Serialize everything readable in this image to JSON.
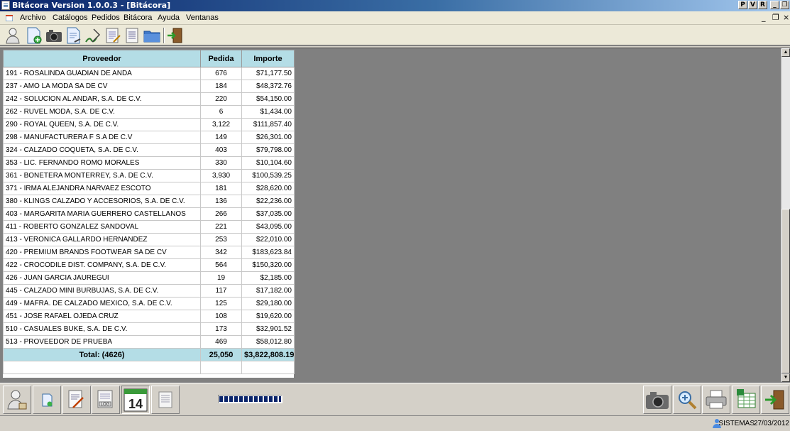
{
  "window": {
    "title": "Bitácora Version 1.0.0.3 - [Bitácora]",
    "caption_buttons": [
      "P",
      "V",
      "R",
      "_",
      "❐",
      "✕"
    ]
  },
  "menu": {
    "items": [
      "Archivo",
      "Catálogos",
      "Pedidos",
      "Bitácora",
      "Ayuda",
      "Ventanas"
    ],
    "mdi_controls": [
      "_",
      "❐",
      "×"
    ]
  },
  "toolbar": {
    "icons": [
      "user-icon",
      "new-document-icon",
      "camera-icon",
      "document-search-icon",
      "signature-icon",
      "edit-document-icon",
      "list-document-icon",
      "folder-icon",
      "exit-door-icon"
    ]
  },
  "grid": {
    "headers": {
      "proveedor": "Proveedor",
      "pedida": "Pedida",
      "importe": "Importe"
    },
    "rows": [
      {
        "proveedor": "191 - ROSALINDA GUADIAN DE ANDA",
        "pedida": "676",
        "importe": "$71,177.50"
      },
      {
        "proveedor": "237 - AMO LA MODA SA DE CV",
        "pedida": "184",
        "importe": "$48,372.76"
      },
      {
        "proveedor": "242 - SOLUCION AL ANDAR, S.A. DE C.V.",
        "pedida": "220",
        "importe": "$54,150.00"
      },
      {
        "proveedor": "262 - RUVEL MODA, S.A. DE C.V.",
        "pedida": "6",
        "importe": "$1,434.00"
      },
      {
        "proveedor": "290 - ROYAL QUEEN, S.A. DE C.V.",
        "pedida": "3,122",
        "importe": "$111,857.40"
      },
      {
        "proveedor": "298 - MANUFACTURERA F  S.A  DE  C.V",
        "pedida": "149",
        "importe": "$26,301.00"
      },
      {
        "proveedor": "324 - CALZADO COQUETA, S.A. DE C.V.",
        "pedida": "403",
        "importe": "$79,798.00"
      },
      {
        "proveedor": "353 - LIC. FERNANDO ROMO MORALES",
        "pedida": "330",
        "importe": "$10,104.60"
      },
      {
        "proveedor": "361 - BONETERA MONTERREY, S.A. DE C.V.",
        "pedida": "3,930",
        "importe": "$100,539.25"
      },
      {
        "proveedor": "371 - IRMA ALEJANDRA NARVAEZ ESCOTO",
        "pedida": "181",
        "importe": "$28,620.00"
      },
      {
        "proveedor": "380 - KLINGS CALZADO Y ACCESORIOS, S.A. DE C.V.",
        "pedida": "136",
        "importe": "$22,236.00"
      },
      {
        "proveedor": "403 - MARGARITA MARIA GUERRERO CASTELLANOS",
        "pedida": "266",
        "importe": "$37,035.00"
      },
      {
        "proveedor": "411 - ROBERTO GONZALEZ SANDOVAL",
        "pedida": "221",
        "importe": "$43,095.00"
      },
      {
        "proveedor": "413 - VERONICA GALLARDO HERNANDEZ",
        "pedida": "253",
        "importe": "$22,010.00"
      },
      {
        "proveedor": "420 - PREMIUM BRANDS FOOTWEAR SA DE CV",
        "pedida": "342",
        "importe": "$183,623.84"
      },
      {
        "proveedor": "422 - CROCODILE DIST.  COMPANY, S.A. DE C.V.",
        "pedida": "564",
        "importe": "$150,320.00"
      },
      {
        "proveedor": "426 - JUAN GARCIA JAUREGUI",
        "pedida": "19",
        "importe": "$2,185.00"
      },
      {
        "proveedor": "445 - CALZADO MINI BURBUJAS, S.A. DE C.V.",
        "pedida": "117",
        "importe": "$17,182.00"
      },
      {
        "proveedor": "449 - MAFRA. DE CALZADO MEXICO, S.A. DE C.V.",
        "pedida": "125",
        "importe": "$29,180.00"
      },
      {
        "proveedor": "451 - JOSE RAFAEL OJEDA CRUZ",
        "pedida": "108",
        "importe": "$19,620.00"
      },
      {
        "proveedor": "510 - CASUALES BUKE, S.A. DE C.V.",
        "pedida": "173",
        "importe": "$32,901.52"
      },
      {
        "proveedor": "513 - PROVEEDOR DE PRUEBA",
        "pedida": "469",
        "importe": "$58,012.80"
      }
    ],
    "total": {
      "label": "Total:  (4626)",
      "pedida": "25,050",
      "importe": "$3,822,808.19"
    }
  },
  "bottombar": {
    "calendar_day": "14",
    "log_label": "LOG",
    "left_icons": [
      "user-box-icon",
      "new-document-icon",
      "signature-document-icon",
      "log-icon",
      "calendar-icon",
      "report-icon"
    ],
    "right_icons": [
      "camera-icon",
      "zoom-in-icon",
      "printer-icon",
      "excel-icon",
      "exit-door-icon"
    ],
    "progress": 1.0
  },
  "status": {
    "user": "SISTEMAS",
    "date": "27/03/2012"
  },
  "colors": {
    "header_bg": "#b4dde6",
    "workspace_bg": "#808080",
    "title_gradient_start": "#0a246a"
  }
}
